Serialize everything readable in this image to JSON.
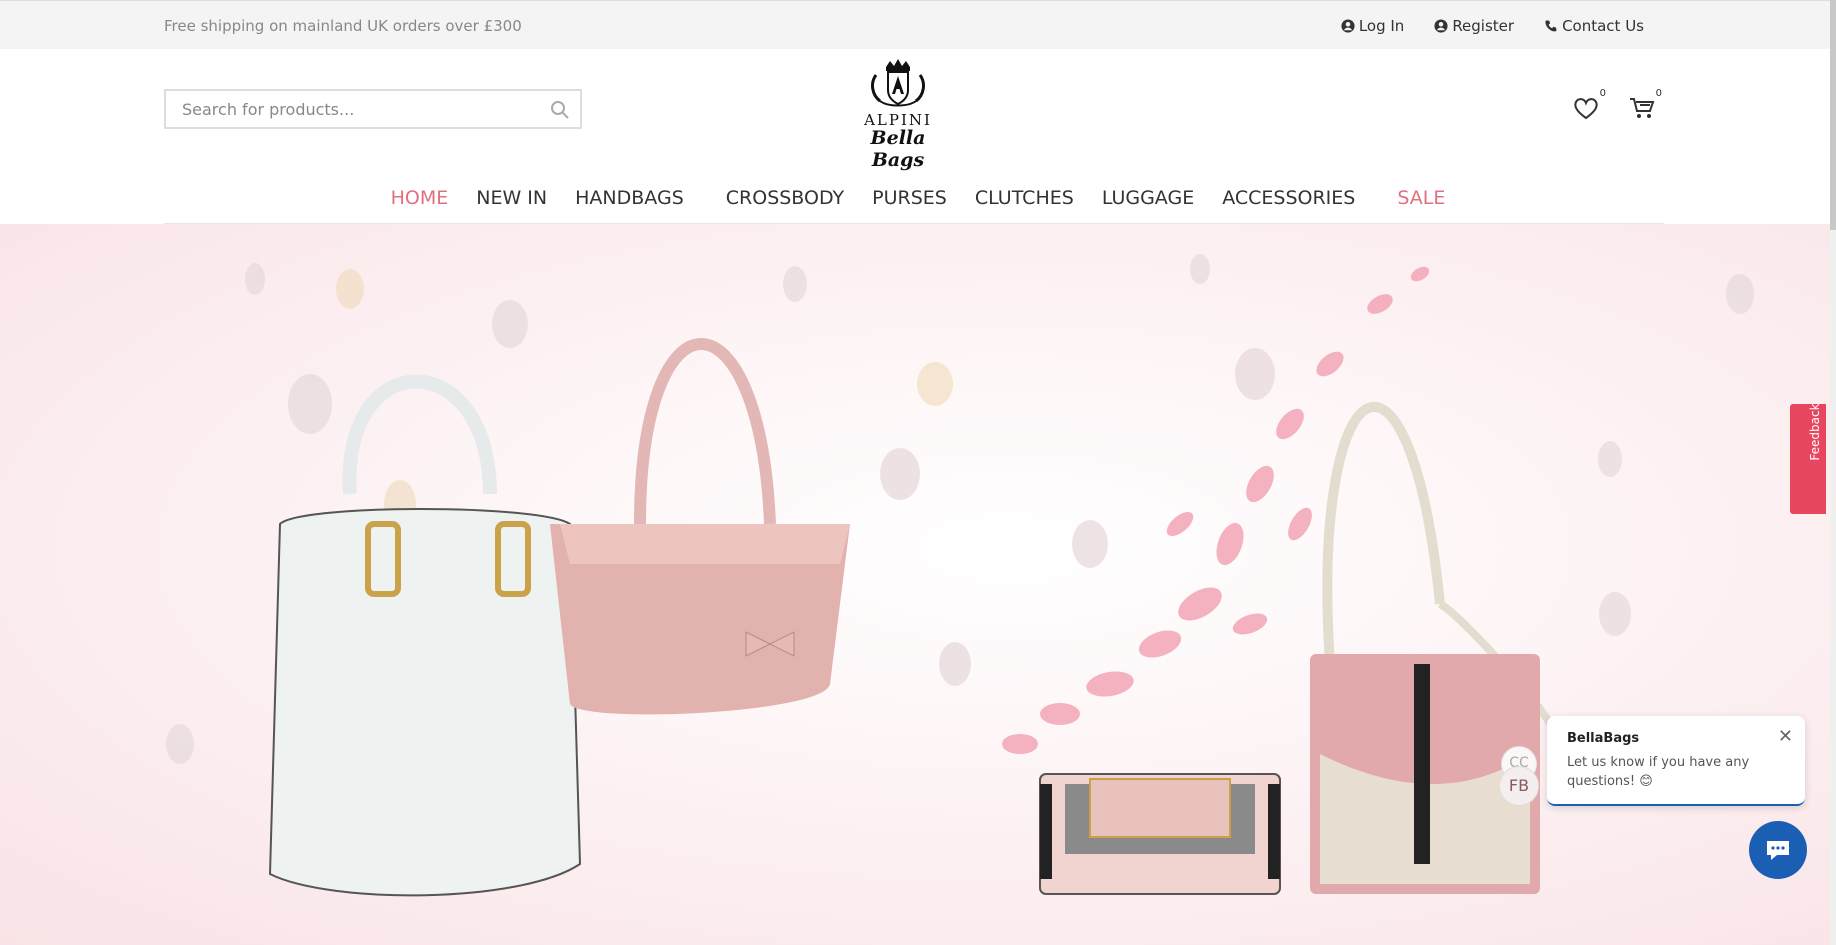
{
  "topbar": {
    "shipping_text": "Free shipping on mainland UK orders over £300",
    "links": {
      "login": "Log In",
      "register": "Register",
      "contact": "Contact Us"
    }
  },
  "header": {
    "search_placeholder": "Search for products...",
    "logo": {
      "line1": "ALPINI",
      "line2": "Bella Bags"
    },
    "wishlist_count": "0",
    "cart_count": "0"
  },
  "nav": {
    "items": [
      "HOME",
      "NEW IN",
      "HANDBAGS",
      "CROSSBODY",
      "PURSES",
      "CLUTCHES",
      "LUGGAGE",
      "ACCESSORIES",
      "SALE"
    ]
  },
  "feedback_label": "Feedback",
  "chat": {
    "title": "BellaBags",
    "message": "Let us know if you have any questions! 😊",
    "avatar_text": "FB",
    "avatar_text_back": "CC"
  },
  "colors": {
    "accent": "#e0707f",
    "chat_blue": "#1a5fb4",
    "feedback_red": "#e8455e"
  }
}
